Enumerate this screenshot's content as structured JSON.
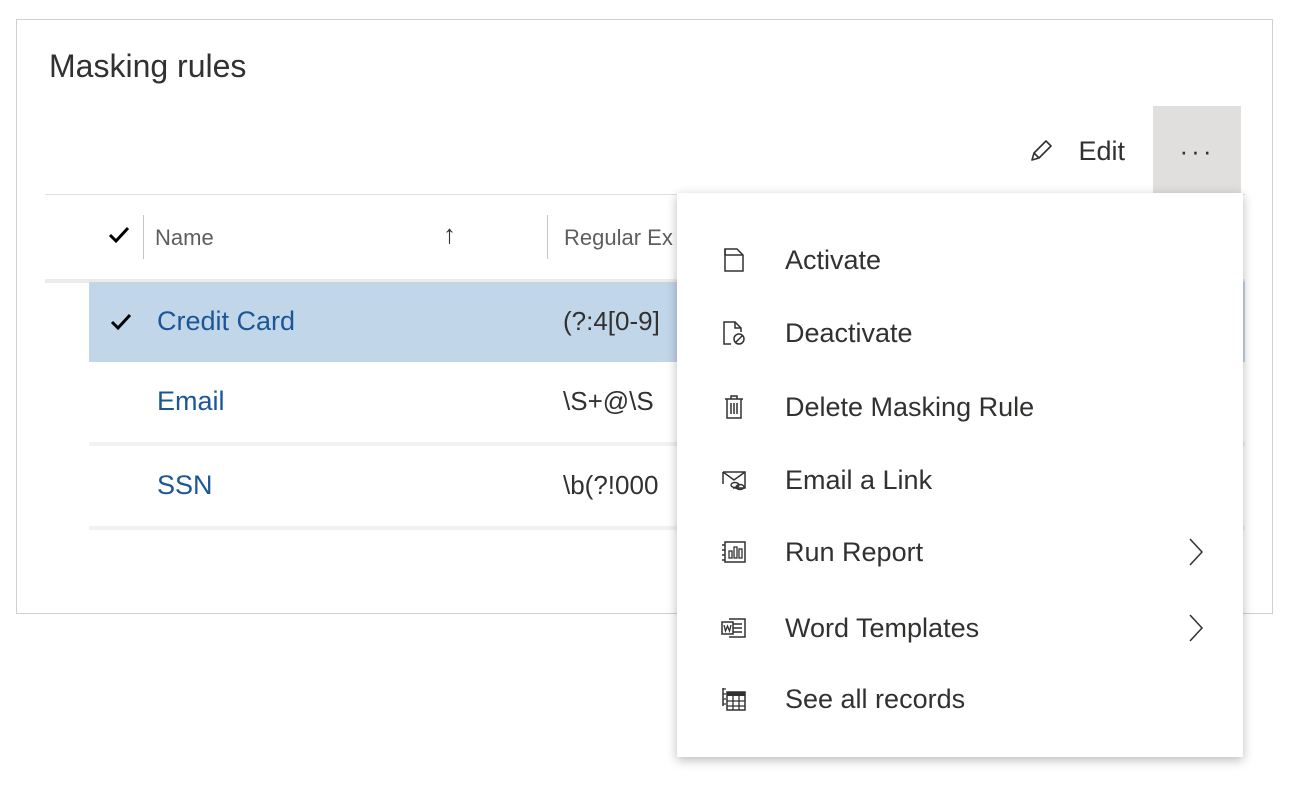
{
  "panel": {
    "title": "Masking rules"
  },
  "toolbar": {
    "edit_label": "Edit",
    "more_label": "···"
  },
  "grid": {
    "columns": {
      "name": "Name",
      "sort_indicator": "↑",
      "regex": "Regular Ex"
    },
    "rows": [
      {
        "name": "Credit Card",
        "regex": "(?:4[0-9]",
        "selected": true
      },
      {
        "name": "Email",
        "regex": "\\S+@\\S",
        "selected": false
      },
      {
        "name": "SSN",
        "regex": "\\b(?!000",
        "selected": false
      }
    ]
  },
  "menu": {
    "items": [
      {
        "label": "Activate",
        "icon": "activate-icon"
      },
      {
        "label": "Deactivate",
        "icon": "deactivate-icon"
      },
      {
        "label": "Delete Masking Rule",
        "icon": "trash-icon"
      },
      {
        "label": "Email a Link",
        "icon": "email-link-icon"
      },
      {
        "label": "Run Report",
        "icon": "report-icon",
        "submenu": true
      },
      {
        "label": "Word Templates",
        "icon": "word-template-icon",
        "submenu": true
      },
      {
        "label": "See all records",
        "icon": "table-icon"
      }
    ]
  }
}
